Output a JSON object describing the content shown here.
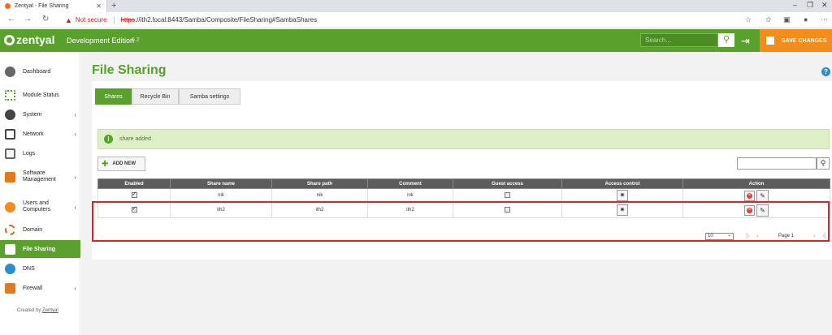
{
  "browser": {
    "tab_title": "Zentyal - File Sharing",
    "new_tab": "+",
    "not_secure": "Not secure",
    "url_proto": "https",
    "url_rest": "://ith2.local:8443/Samba/Composite/FileSharing#SambaShares"
  },
  "header": {
    "logo": "zentyal",
    "edition": "Development Edition",
    "version": "6.2",
    "search_placeholder": "Search...",
    "save_label": "SAVE CHANGES"
  },
  "sidebar": {
    "items": [
      {
        "label": "Dashboard"
      },
      {
        "label": "Module Status"
      },
      {
        "label": "System"
      },
      {
        "label": "Network"
      },
      {
        "label": "Logs"
      },
      {
        "label": "Software Management"
      },
      {
        "label": "Users and Computers"
      },
      {
        "label": "Domain"
      },
      {
        "label": "File Sharing"
      },
      {
        "label": "DNS"
      },
      {
        "label": "Firewall"
      }
    ],
    "created_by": "Created by",
    "created_by_link": "Zentyal"
  },
  "page": {
    "title": "File Sharing",
    "tabs": [
      "Shares",
      "Recycle Bin",
      "Samba settings"
    ],
    "message": "share added",
    "add_new": "ADD NEW"
  },
  "table": {
    "headers": [
      "Enabled",
      "Share name",
      "Share path",
      "Comment",
      "Guest access",
      "Access control",
      "Action"
    ],
    "rows": [
      {
        "name": "nik",
        "path": "nik",
        "comment": "nik",
        "enabled": true,
        "guest": false
      },
      {
        "name": "ith2",
        "path": "ith2",
        "comment": "ith2",
        "enabled": true,
        "guest": false
      }
    ],
    "page_size": "10",
    "page_label": "Page 1"
  },
  "colors": {
    "brand_green": "#5aa02c",
    "save_orange": "#f28c1c",
    "highlight_red": "#e0202a"
  }
}
